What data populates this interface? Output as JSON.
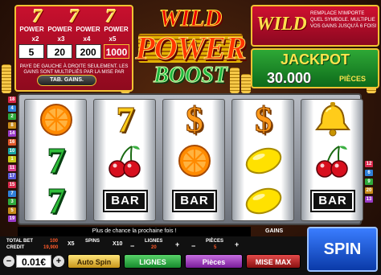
{
  "paytable": {
    "sevens": [
      "7",
      "7",
      "7"
    ],
    "powers": [
      "POWER",
      "POWER",
      "POWER",
      "POWER"
    ],
    "multipliers": [
      "x2",
      "x3",
      "x4",
      "x5"
    ],
    "values": [
      "5",
      "20",
      "200",
      "1000"
    ],
    "note": "PAYE DE GAUCHE À DROITE SEULEMENT. LES GAINS SONT MULTIPLIÉS PAR LA MISE PAR LIGNE.",
    "tab_gains": "TAB. GAINS."
  },
  "logo": {
    "line1": "WILD",
    "line2": "POWER",
    "line3": "BOOST"
  },
  "wild_info": {
    "title": "WILD",
    "text": "REMPLACE N'IMPORTE QUEL SYMBOLE. MULTIPLIE VOS GAINS JUSQU'À 6 FOIS!"
  },
  "jackpot": {
    "label": "JACKPOT",
    "value": "30.000",
    "unit": "PIÈCES"
  },
  "reels": [
    [
      "orange",
      "seven-green",
      "seven-green"
    ],
    [
      "seven-gold",
      "cherries",
      "bar"
    ],
    [
      "dollar",
      "orange",
      "bar"
    ],
    [
      "dollar",
      "lemon",
      "lemon"
    ],
    [
      "bell",
      "cherries",
      "bar"
    ]
  ],
  "symbol_text": {
    "bar": "BAR",
    "seven": "7",
    "dollar": "$"
  },
  "line_numbers_left": [
    "18",
    "4",
    "2",
    "8",
    "14",
    "16",
    "10",
    "1",
    "11",
    "17",
    "15",
    "7",
    "3",
    "5",
    "19"
  ],
  "line_numbers_right": [
    "12",
    "6",
    "9",
    "20",
    "13"
  ],
  "message": "Plus de chance la prochaine fois !",
  "controls": {
    "total_bet_label": "TOTAL BET",
    "total_bet_value": "100",
    "credit_label": "CREDIT",
    "credit_value": "19,900",
    "spins_label": "SPINS",
    "lignes_label": "LIGNES",
    "lignes_value": "20",
    "pieces_label": "PIÈCES",
    "pieces_value": "5",
    "gains_label": "GAINS",
    "x5": "X5",
    "x10": "X10",
    "coin_value": "0.01€",
    "minus": "−",
    "plus": "+",
    "autospin": "Auto Spin",
    "lignes": "LIGNES",
    "pieces": "Pièces",
    "misemax": "MISE MAX",
    "spin": "SPIN"
  },
  "colors": {
    "red_panel": "#c8102e",
    "gold_border": "#f1c232",
    "green_panel": "#2ea836",
    "spin_blue": "#3a7dff"
  }
}
